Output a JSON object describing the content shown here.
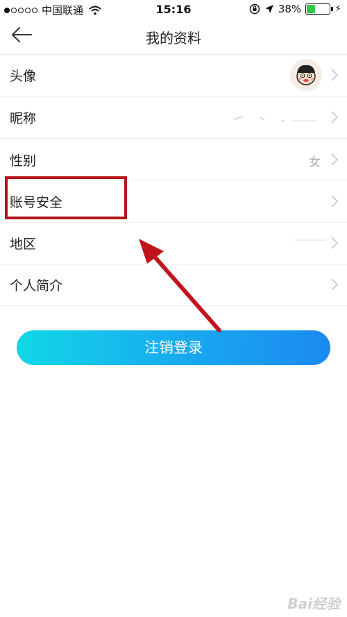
{
  "status_bar": {
    "carrier": "中国联通",
    "time": "15:16",
    "battery_text": "38%",
    "battery_level": 0.38,
    "colors": {
      "battery_fill": "#2ecc40"
    },
    "icons": [
      "signal-dots-icon",
      "wifi-icon",
      "orientation-lock-icon",
      "location-arrow-icon",
      "battery-icon",
      "charging-bolt-icon"
    ]
  },
  "nav": {
    "title": "我的资料",
    "back_icon": "back-arrow-icon"
  },
  "rows": [
    {
      "label": "头像",
      "value": ""
    },
    {
      "label": "昵称",
      "value": ""
    },
    {
      "label": "性别",
      "value": "女"
    },
    {
      "label": "账号安全",
      "value": ""
    },
    {
      "label": "地区",
      "value": ""
    },
    {
      "label": "个人简介",
      "value": ""
    }
  ],
  "logout_button": {
    "label": "注销登录"
  },
  "annotation": {
    "highlight_color": "#b3141a",
    "highlighted_row": "账号安全"
  },
  "watermark": {
    "text": "Bai经验"
  },
  "colors": {
    "button_gradient_start": "#11d7e6",
    "button_gradient_end": "#1a8af0",
    "divider": "#efefef"
  }
}
